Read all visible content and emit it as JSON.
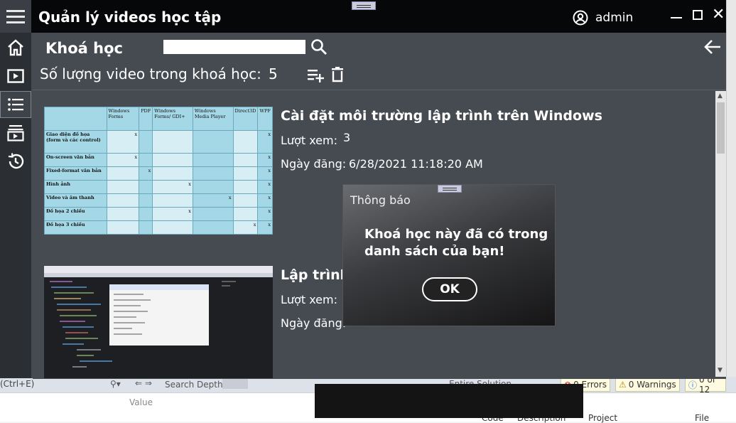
{
  "app": {
    "title": "Quản lý videos học tập",
    "user": "admin"
  },
  "header": {
    "section_title": "Khoá học",
    "search_value": "",
    "count_label": "Số lượng video trong khoá học:",
    "count_value": "5"
  },
  "videos": [
    {
      "title": "Cài  đặt môi trường lập trình trên Windows",
      "views_label": "Lượt xem:",
      "views": "3",
      "date_label": "Ngày đăng:",
      "date": "6/28/2021 11:18:20 AM"
    },
    {
      "title": "Lập trình",
      "views_label": "Lượt xem:",
      "views": "",
      "date_label": "Ngày đăng:",
      "date": ""
    }
  ],
  "thumb_table": {
    "headers": [
      "",
      "Windows Forms",
      "PDF",
      "Windows Forms/ GDI+",
      "Windows Media Player",
      "Direct3D",
      "WPF"
    ],
    "rows": [
      [
        "Giao diện đồ họa (form và các control)",
        "x",
        "",
        "",
        "",
        "",
        "x"
      ],
      [
        "On-screen văn bản",
        "x",
        "",
        "",
        "",
        "",
        "x"
      ],
      [
        "Fixed-format văn bản",
        "",
        "x",
        "",
        "",
        "",
        "x"
      ],
      [
        "Hình ảnh",
        "",
        "",
        "x",
        "",
        "",
        "x"
      ],
      [
        "Video và âm thanh",
        "",
        "",
        "",
        "x",
        "",
        "x"
      ],
      [
        "Đồ họa 2 chiều",
        "",
        "",
        "x",
        "",
        "",
        "x"
      ],
      [
        "Đồ họa 3 chiều",
        "",
        "",
        "",
        "",
        "x",
        "x"
      ]
    ]
  },
  "dialog": {
    "title": "Thông báo",
    "message": "Khoá học này đã có trong danh sách của bạn!",
    "ok_label": "OK"
  },
  "ide": {
    "search_hint": "(Ctrl+E)",
    "search_depth": "Search Depth:",
    "scope": "Entire Solution",
    "errors": "0 Errors",
    "warnings": "0 Warnings",
    "messages": "0 of 12",
    "col_value": "Value",
    "col_code": "Code",
    "col_description": "Description",
    "col_project": "Project",
    "col_file": "File"
  },
  "icons": {
    "menu": "hamburger-icon",
    "home": "home-icon",
    "play": "play-icon",
    "list": "list-icon",
    "playlist": "playlist-icon",
    "history": "history-icon",
    "user": "user-circle-icon",
    "search": "search-icon",
    "back": "arrow-left-icon",
    "add": "playlist-add-icon",
    "delete": "trash-icon"
  }
}
